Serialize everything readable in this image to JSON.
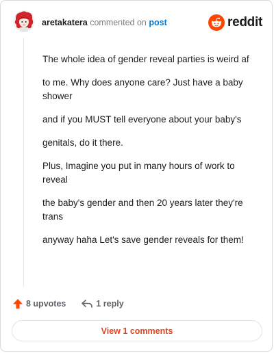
{
  "header": {
    "username": "aretakatera",
    "action_text": "commented on",
    "link_text": "post",
    "brand_name": "reddit",
    "brand_color": "#ff4500"
  },
  "comment": {
    "paragraphs": [
      "The whole idea of gender reveal parties is weird af",
      "to me. Why does anyone care? Just have a baby shower",
      "and if you MUST tell everyone about your baby's",
      "genitals, do it there.",
      "Plus, Imagine you put in many hours of work to reveal",
      "the baby's gender and then 20 years later they're trans",
      "anyway haha Let's save gender reveals for them!"
    ]
  },
  "actions": {
    "upvotes_label": "8 upvotes",
    "replies_label": "1 reply",
    "upvote_icon": "upvote-arrow-icon",
    "reply_icon": "reply-icon"
  },
  "footer": {
    "view_comments_label": "View 1 comments",
    "accent_color": "#e0451c"
  }
}
